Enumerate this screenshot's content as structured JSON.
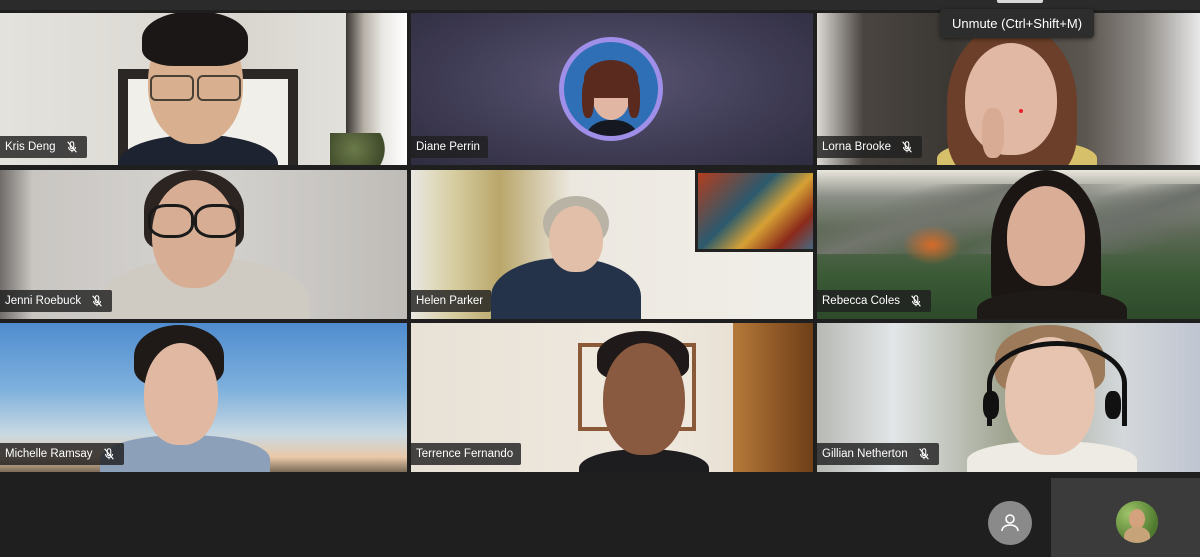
{
  "tooltip": {
    "text": "Unmute (Ctrl+Shift+M)"
  },
  "participants": [
    {
      "name": "Kris Deng",
      "muted": true,
      "mic_icon": "mic-off-icon"
    },
    {
      "name": "Diane Perrin",
      "muted": false,
      "avatar": true
    },
    {
      "name": "Lorna Brooke",
      "muted": true,
      "mic_icon": "mic-off-icon"
    },
    {
      "name": "Jenni Roebuck",
      "muted": true,
      "mic_icon": "mic-off-icon"
    },
    {
      "name": "Helen Parker",
      "muted": false
    },
    {
      "name": "Rebecca Coles",
      "muted": true,
      "mic_icon": "mic-off-icon"
    },
    {
      "name": "Michelle Ramsay",
      "muted": true,
      "mic_icon": "mic-off-icon"
    },
    {
      "name": "Terrence Fernando",
      "muted": false
    },
    {
      "name": "Gillian Netherton",
      "muted": true,
      "mic_icon": "mic-off-icon"
    }
  ],
  "self_view": {
    "avatar_icon": "self-avatar",
    "person_icon": "person-icon"
  },
  "colors": {
    "tile_bg": "#444444",
    "name_tag_bg": "#202020",
    "avatar_ring": "#9f8fe8",
    "background": "#1f1f1f"
  }
}
